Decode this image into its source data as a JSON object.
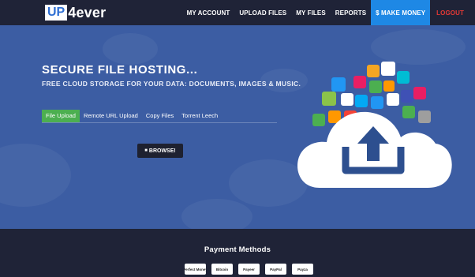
{
  "brand": {
    "logo_box": "UP",
    "logo_rest": "4ever"
  },
  "nav": {
    "my_account": "MY ACCOUNT",
    "upload_files": "UPLOAD FILES",
    "my_files": "MY FILES",
    "reports": "REPORTS",
    "make_money": "$ MAKE MONEY",
    "logout": "LOGOUT"
  },
  "hero": {
    "title": "SECURE FILE HOSTING...",
    "subtitle": "FREE CLOUD STORAGE FOR YOUR DATA: DOCUMENTS, IMAGES & MUSIC.",
    "tabs": [
      {
        "label": "File Upload",
        "active": true
      },
      {
        "label": "Remote URL Upload",
        "active": false
      },
      {
        "label": "Copy Files",
        "active": false
      },
      {
        "label": "Torrent Leech",
        "active": false
      }
    ],
    "browse_label": "BROWSE!"
  },
  "footer": {
    "payment_title": "Payment Methods",
    "payment_logos": [
      "Perfect Money",
      "Bitcoin",
      "Payeer",
      "PayPal",
      "Payza"
    ]
  },
  "colors": {
    "topbar": "#1f2337",
    "hero_bg": "#3c5da3",
    "accent_green": "#4caf50",
    "money_blue": "#1e88e5",
    "logout_red": "#e53935",
    "cloud_upload_icon": "#2d4f8f"
  }
}
